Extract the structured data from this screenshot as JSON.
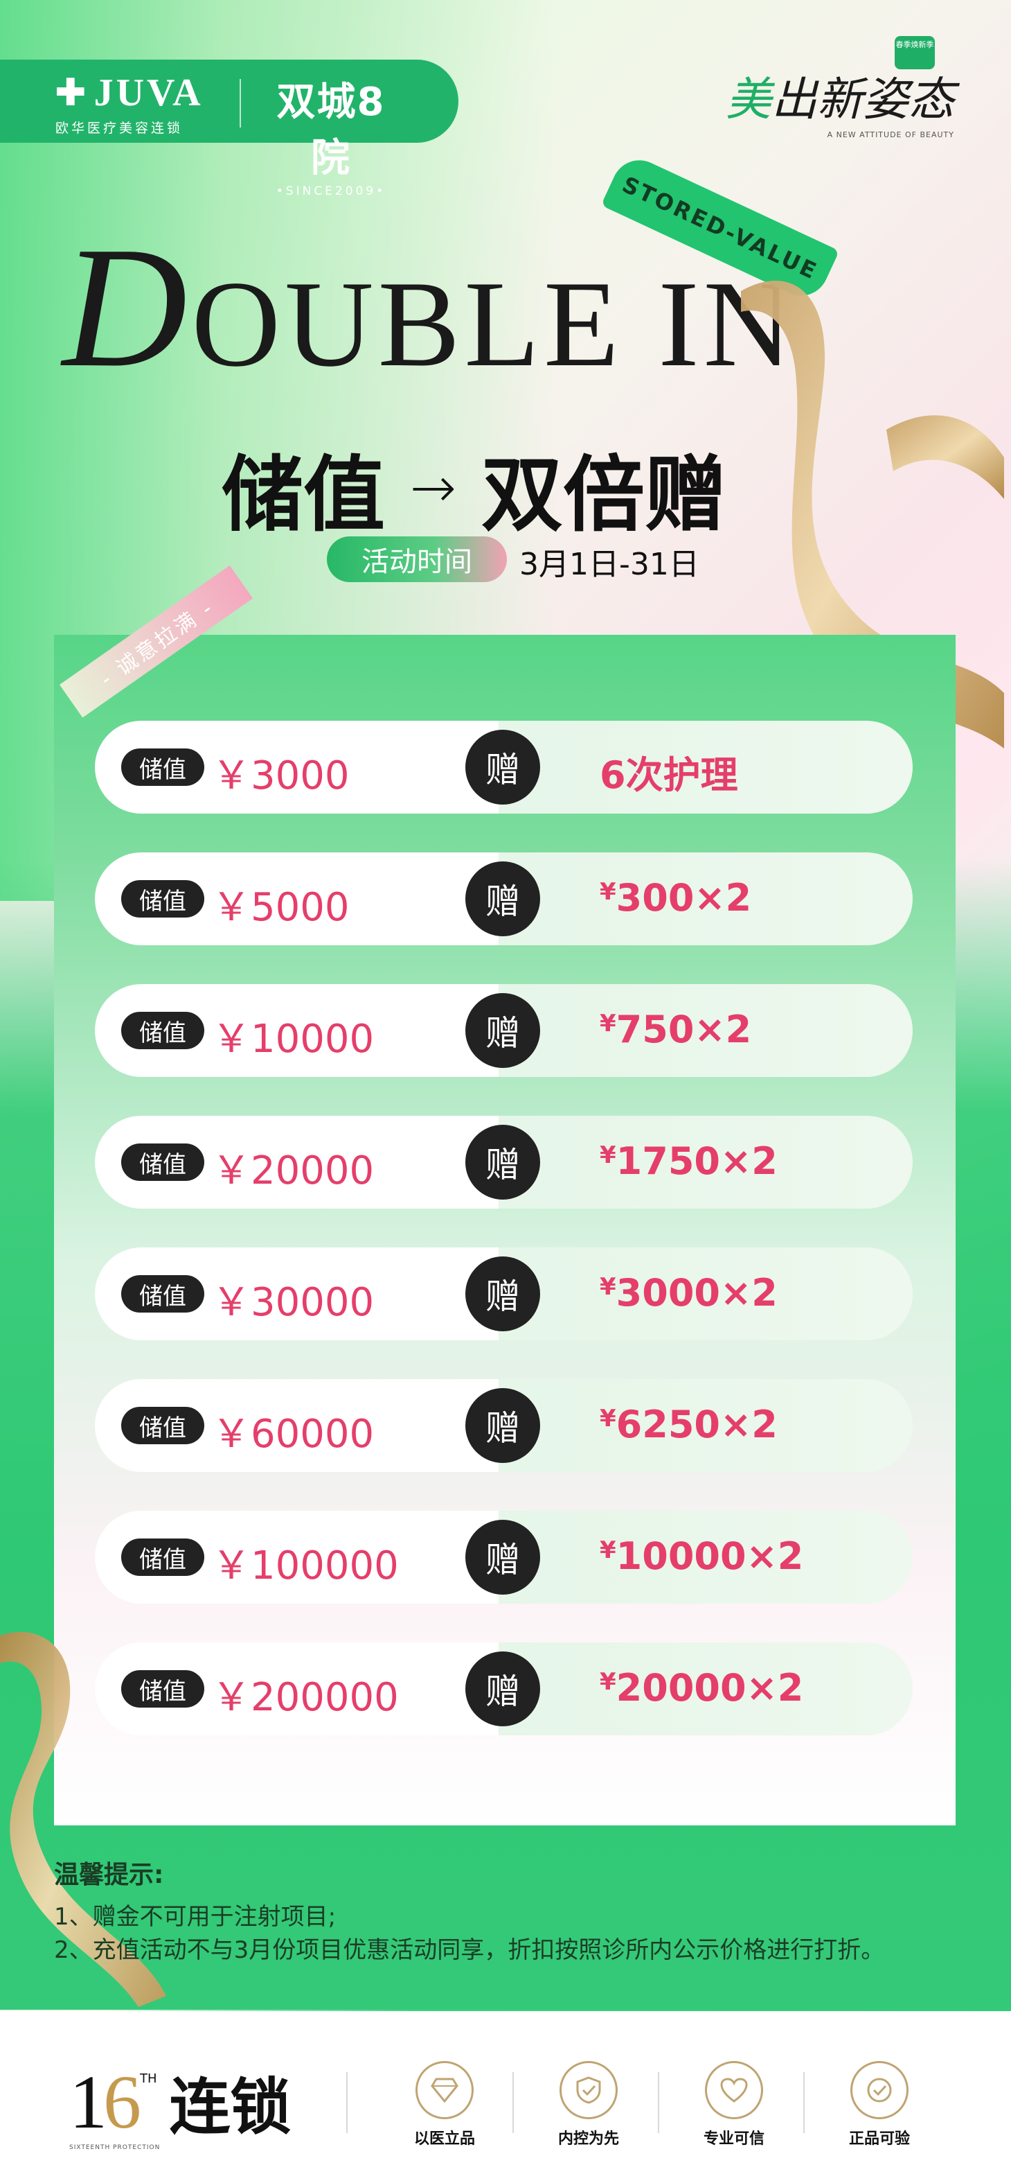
{
  "header": {
    "brand_logo": "JUVA",
    "brand_sub": "欧华医疗美容连锁",
    "brand_title": "双城8院",
    "brand_since": "•SINCE2009•",
    "slogan": "美出新姿态",
    "slogan_sub": "A NEW ATTITUDE OF BEAUTY",
    "slogan_badge": "春季焕新季"
  },
  "hero": {
    "title_en_first": "D",
    "title_en_rest": "OUBLE IN",
    "stored_badge": "STORED-VALUE",
    "title_cn_left": "储值",
    "title_cn_arrow": "→",
    "title_cn_right": "双倍赠",
    "date_label": "活动时间",
    "date_value": "3月1日-31日"
  },
  "panel": {
    "corner_tag": "- 诚意拉满 -",
    "rows": [
      {
        "label": "储值",
        "amount": "￥3000",
        "gift_icon": "赠",
        "gift_yen": "",
        "gift": "6次护理"
      },
      {
        "label": "储值",
        "amount": "￥5000",
        "gift_icon": "赠",
        "gift_yen": "¥",
        "gift": "300×2"
      },
      {
        "label": "储值",
        "amount": "￥10000",
        "gift_icon": "赠",
        "gift_yen": "¥",
        "gift": "750×2"
      },
      {
        "label": "储值",
        "amount": "￥20000",
        "gift_icon": "赠",
        "gift_yen": "¥",
        "gift": "1750×2"
      },
      {
        "label": "储值",
        "amount": "￥30000",
        "gift_icon": "赠",
        "gift_yen": "¥",
        "gift": "3000×2"
      },
      {
        "label": "储值",
        "amount": "￥60000",
        "gift_icon": "赠",
        "gift_yen": "¥",
        "gift": "6250×2"
      },
      {
        "label": "储值",
        "amount": "￥100000",
        "gift_icon": "赠",
        "gift_yen": "¥",
        "gift": "10000×2"
      },
      {
        "label": "储值",
        "amount": "￥200000",
        "gift_icon": "赠",
        "gift_yen": "¥",
        "gift": "20000×2"
      }
    ]
  },
  "tips": {
    "title": "温馨提示:",
    "line1": "1、赠金不可用于注射项目;",
    "line2": "2、充值活动不与3月份项目优惠活动同享，折扣按照诊所内公示价格进行打折。"
  },
  "footer": {
    "logo_digit1": "1",
    "logo_digit2": "6",
    "logo_th": "TH",
    "logo_text": "连锁",
    "logo_sub": "SIXTEENTH PROTECTION",
    "badges": [
      {
        "label": "以医立品",
        "icon": "diamond-icon"
      },
      {
        "label": "内控为先",
        "icon": "shield-icon"
      },
      {
        "label": "专业可信",
        "icon": "heart-icon"
      },
      {
        "label": "正品可验",
        "icon": "verified-icon"
      }
    ]
  },
  "colors": {
    "brand_green": "#22b36a",
    "accent_red": "#e53e6a",
    "dark": "#222222",
    "gold": "#c59a4e"
  }
}
